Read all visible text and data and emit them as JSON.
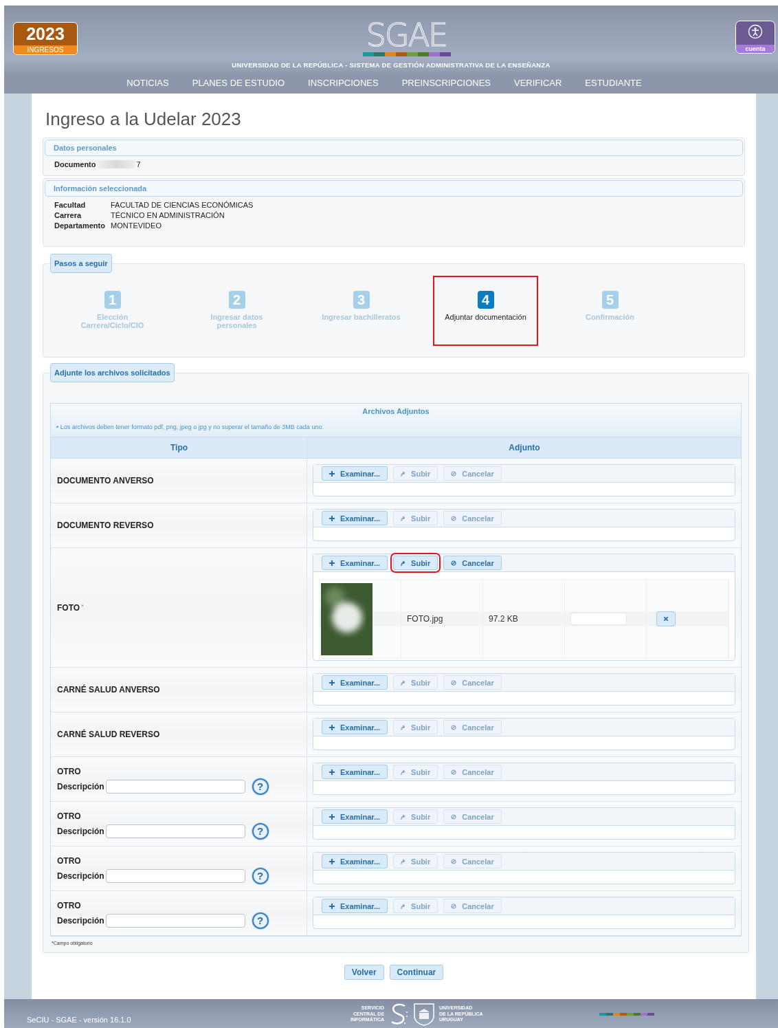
{
  "header": {
    "badge_year": "2023",
    "badge_label": "INGRESOS",
    "logo": "SGAE",
    "subtitle": "UNIVERSIDAD DE LA REPÚBLICA - SISTEMA DE GESTIÓN ADMINISTRATIVA DE LA ENSEÑANZA",
    "account": "cuenta"
  },
  "nav": [
    "NOTICIAS",
    "PLANES DE ESTUDIO",
    "INSCRIPCIONES",
    "PREINSCRIPCIONES",
    "VERIFICAR",
    "ESTUDIANTE"
  ],
  "page_title": "Ingreso a la Udelar 2023",
  "personal": {
    "title": "Datos personales",
    "fields": [
      {
        "label": "Documento",
        "value": "7",
        "redacted": true
      }
    ]
  },
  "selected_info": {
    "title": "Información seleccionada",
    "fields": [
      {
        "label": "Facultad",
        "value": "FACULTAD DE CIENCIAS ECONÓMICAS"
      },
      {
        "label": "Carrera",
        "value": "TÉCNICO EN ADMINISTRACIÓN"
      },
      {
        "label": "Departamento",
        "value": "MONTEVIDEO"
      }
    ]
  },
  "steps": {
    "title": "Pasos a seguir",
    "items": [
      {
        "number": "1",
        "label": "Elección Carrera/Ciclo/CIO",
        "selected": false,
        "highlighted": false
      },
      {
        "number": "2",
        "label": "Ingresar datos personales",
        "selected": false,
        "highlighted": false
      },
      {
        "number": "3",
        "label": "Ingresar bachilleratos",
        "selected": false,
        "highlighted": false
      },
      {
        "number": "4",
        "label": "Adjuntar documentación",
        "selected": true,
        "highlighted": true
      },
      {
        "number": "5",
        "label": "Confirmación",
        "selected": false,
        "highlighted": false
      }
    ]
  },
  "attachments": {
    "title": "Adjunte los archivos solicitados",
    "box_title": "Archivos Adjuntos",
    "note": "• Los archivos deben tener formato pdf, png, jpeg o jpg y no superar el tamaño de 3MB cada uno.",
    "columns": [
      "Tipo",
      "Adjunto"
    ],
    "rows": [
      {
        "kind": "file",
        "type": "DOCUMENTO ANVERSO",
        "buttons": [
          {
            "kind": "browse",
            "label": "Examinar...",
            "disabled": false,
            "highlighted": false
          },
          {
            "kind": "upload",
            "label": "Subir",
            "disabled": true,
            "highlighted": false
          },
          {
            "kind": "cancel",
            "label": "Cancelar",
            "disabled": true,
            "highlighted": false
          }
        ]
      },
      {
        "kind": "file",
        "type": "DOCUMENTO REVERSO",
        "buttons": [
          {
            "kind": "browse",
            "label": "Examinar...",
            "disabled": false,
            "highlighted": false
          },
          {
            "kind": "upload",
            "label": "Subir",
            "disabled": true,
            "highlighted": false
          },
          {
            "kind": "cancel",
            "label": "Cancelar",
            "disabled": true,
            "highlighted": false
          }
        ]
      },
      {
        "kind": "file",
        "type": "FOTO",
        "required_mark": "*",
        "buttons": [
          {
            "kind": "browse",
            "label": "Examinar...",
            "disabled": false,
            "highlighted": false
          },
          {
            "kind": "upload",
            "label": "Subir",
            "disabled": false,
            "highlighted": true
          },
          {
            "kind": "cancel",
            "label": "Cancelar",
            "disabled": false,
            "highlighted": false
          }
        ],
        "file": {
          "name": "FOTO.jpg",
          "size": "97.2 KB",
          "level": 0
        }
      },
      {
        "kind": "file",
        "type": "CARNÉ SALUD ANVERSO",
        "buttons": [
          {
            "kind": "browse",
            "label": "Examinar...",
            "disabled": false,
            "highlighted": false
          },
          {
            "kind": "upload",
            "label": "Subir",
            "disabled": true,
            "highlighted": false
          },
          {
            "kind": "cancel",
            "label": "Cancelar",
            "disabled": true,
            "highlighted": false
          }
        ]
      },
      {
        "kind": "file",
        "type": "CARNÉ SALUD REVERSO",
        "buttons": [
          {
            "kind": "browse",
            "label": "Examinar...",
            "disabled": false,
            "highlighted": false
          },
          {
            "kind": "upload",
            "label": "Subir",
            "disabled": true,
            "highlighted": false
          },
          {
            "kind": "cancel",
            "label": "Cancelar",
            "disabled": true,
            "highlighted": false
          }
        ]
      },
      {
        "kind": "other",
        "type": "OTRO",
        "description_label": "Descripción",
        "help": "?",
        "buttons": [
          {
            "kind": "browse",
            "label": "Examinar...",
            "disabled": false,
            "highlighted": false
          },
          {
            "kind": "upload",
            "label": "Subir",
            "disabled": true,
            "highlighted": false
          },
          {
            "kind": "cancel",
            "label": "Cancelar",
            "disabled": true,
            "highlighted": false
          }
        ]
      },
      {
        "kind": "other",
        "type": "OTRO",
        "description_label": "Descripción",
        "help": "?",
        "buttons": [
          {
            "kind": "browse",
            "label": "Examinar...",
            "disabled": false,
            "highlighted": false
          },
          {
            "kind": "upload",
            "label": "Subir",
            "disabled": true,
            "highlighted": false
          },
          {
            "kind": "cancel",
            "label": "Cancelar",
            "disabled": true,
            "highlighted": false
          }
        ]
      },
      {
        "kind": "other",
        "type": "OTRO",
        "description_label": "Descripción",
        "help": "?",
        "buttons": [
          {
            "kind": "browse",
            "label": "Examinar...",
            "disabled": false,
            "highlighted": false
          },
          {
            "kind": "upload",
            "label": "Subir",
            "disabled": true,
            "highlighted": false
          },
          {
            "kind": "cancel",
            "label": "Cancelar",
            "disabled": true,
            "highlighted": false
          }
        ]
      },
      {
        "kind": "other",
        "type": "OTRO",
        "description_label": "Descripción",
        "help": "?",
        "buttons": [
          {
            "kind": "browse",
            "label": "Examinar...",
            "disabled": false,
            "highlighted": false
          },
          {
            "kind": "upload",
            "label": "Subir",
            "disabled": true,
            "highlighted": false
          },
          {
            "kind": "cancel",
            "label": "Cancelar",
            "disabled": true,
            "highlighted": false
          }
        ]
      }
    ],
    "footnote": "*Campo obligatorio"
  },
  "actions": [
    "Volver",
    "Continuar"
  ],
  "footer": {
    "version": "SeCIU - SGAE - versión 16.1.0",
    "org_left": [
      "SERVICIO",
      "CENTRAL DE",
      "INFORMÁTICA"
    ],
    "org_right": [
      "UNIVERSIDAD",
      "DE LA REPÚBLICA",
      "URUGUAY"
    ]
  }
}
